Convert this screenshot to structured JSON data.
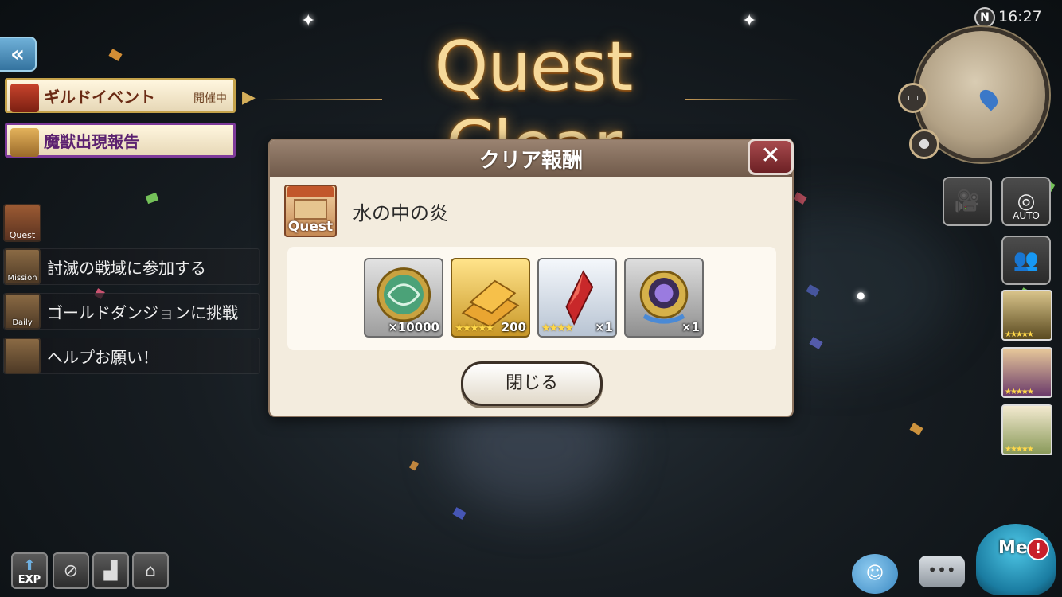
{
  "title": "Quest Clear",
  "clock": "16:27",
  "compass": "N",
  "banners": [
    {
      "label": "ギルドイベント",
      "status": "開催中"
    },
    {
      "label": "魔獣出現報告"
    }
  ],
  "sidebar": {
    "quest_tag": "Quest",
    "missions": [
      {
        "tag": "Mission",
        "text": "討滅の戦域に参加する"
      },
      {
        "tag": "Daily",
        "text": "ゴールドダンジョンに挑戦"
      },
      {
        "tag": "",
        "text": "ヘルプお願い！"
      }
    ]
  },
  "modal": {
    "header": "クリア報酬",
    "quest_badge": "Quest",
    "quest_name": "水の中の炎",
    "rewards": [
      {
        "icon": "medal-icon",
        "stars": "",
        "qty": "×10000"
      },
      {
        "icon": "gold-bars-icon",
        "stars": "★★★★★",
        "qty": "200"
      },
      {
        "icon": "red-crystal-icon",
        "stars": "★★★★",
        "qty": "×1"
      },
      {
        "icon": "spirit-stone-icon",
        "stars": "",
        "qty": "×1"
      }
    ],
    "close_label": "閉じる",
    "close_icon": "✕"
  },
  "right": {
    "auto_label": "AUTO",
    "portrait_stars": [
      "★★★★★",
      "★★★★★",
      "★★★★★"
    ]
  },
  "bottom": {
    "exp_label": "EXP",
    "me_label": "Me",
    "alert": "!"
  },
  "colors": {
    "title_gold": "#f6d99a",
    "modal_bg": "#f3ecde",
    "header_brown": "#8a7260",
    "close_red": "#8c3034",
    "guild_border": "#c4a24a",
    "beast_border": "#7e3a9a"
  }
}
